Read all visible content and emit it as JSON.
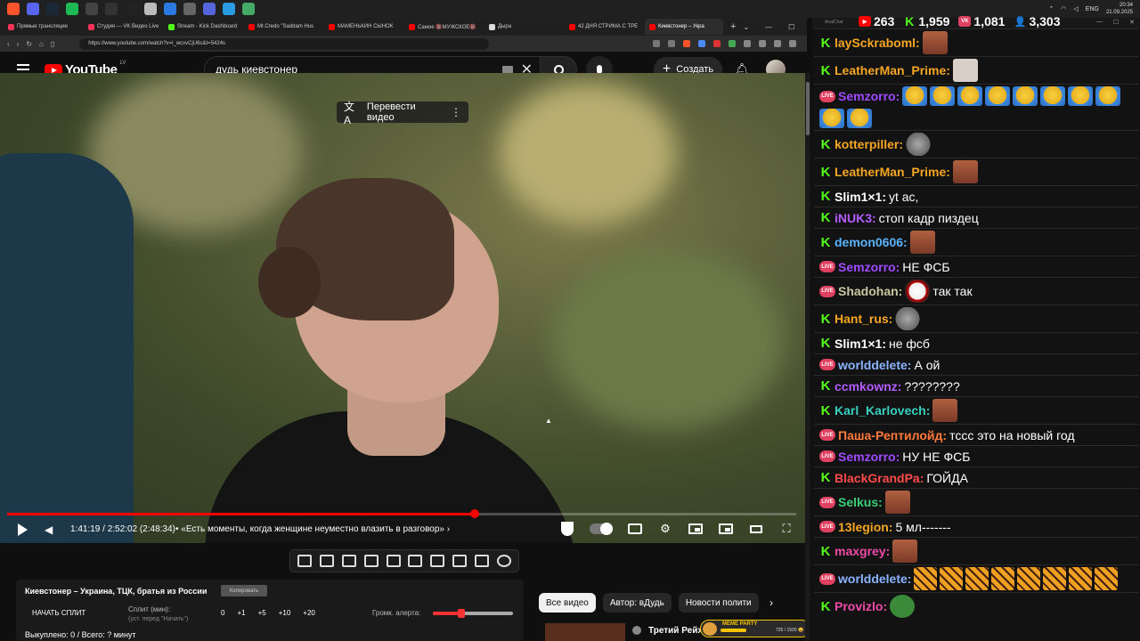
{
  "taskbar": {
    "icons": [
      {
        "name": "brave-icon",
        "color": "#fb542b"
      },
      {
        "name": "discord-icon",
        "color": "#5865f2"
      },
      {
        "name": "steam-icon",
        "color": "#1b2838"
      },
      {
        "name": "spotify-icon",
        "color": "#1db954"
      },
      {
        "name": "app-icon",
        "color": "#444444"
      },
      {
        "name": "epic-icon",
        "color": "#333333"
      },
      {
        "name": "obs-icon",
        "color": "#222222"
      },
      {
        "name": "app-icon",
        "color": "#bbbbbb"
      },
      {
        "name": "app-icon",
        "color": "#2a7ae2"
      },
      {
        "name": "app-icon",
        "color": "#666666"
      },
      {
        "name": "app-icon",
        "color": "#5566dd"
      },
      {
        "name": "app-icon",
        "color": "#2a9ae2"
      },
      {
        "name": "app-icon",
        "color": "#44aa66"
      }
    ],
    "lang": "ENG",
    "time": "20:34",
    "date": "21.09.2025"
  },
  "browser": {
    "tabs": [
      {
        "label": "Прямые трансляции",
        "color": "#ff3355",
        "active": false
      },
      {
        "label": "Студия — VK Видео Live",
        "color": "#ff3355",
        "active": false
      },
      {
        "label": "Stream - Kick Dashboard",
        "color": "#53fc18",
        "active": false
      },
      {
        "label": "Mr.Credo \"Saddam Hus",
        "color": "#ff0000",
        "active": false
      },
      {
        "label": "МАМЕНЬКИН СЫНОК",
        "color": "#ff0000",
        "active": false
      },
      {
        "label": "Самое 🔞МУЖСКОЕ🔞",
        "color": "#ff0000",
        "active": false
      },
      {
        "label": "Дыра",
        "color": "#dddddd",
        "active": false
      },
      {
        "label": "42 ДНЯ СТРИМА С ТРЕ",
        "color": "#ff0000",
        "active": false
      },
      {
        "label": "Киевстонер – Укра",
        "color": "#ff0000",
        "active": true
      }
    ],
    "url": "https://www.youtube.com/watch?v=l_wcxvCjU6c&t=5424s"
  },
  "youtube": {
    "region": "LV",
    "search_query": "дудь киевстонер",
    "create_label": "Создать",
    "translate_label": "Перевести видео",
    "time_display": "1:41:19 / 2:52:02 (2:48:34)",
    "chapter": "• «Есть моменты, когда женщине неуместно влазить в разговор»",
    "progress_fraction": 0.593,
    "chips": [
      {
        "label": "Все видео",
        "active": true
      },
      {
        "label": "Автор: вДудь",
        "active": false
      },
      {
        "label": "Новости полити",
        "active": false
      }
    ],
    "reco_title": "Третий Рейх"
  },
  "split": {
    "title": "Киевстонер – Украина, ТЦК, братья из России",
    "copy_label": "Копировать",
    "start_label": "НАЧАТЬ СПЛИТ",
    "min_label": "Сплит (мин):",
    "min_hint": "(уст. перед \"Начать\")",
    "values": [
      "0",
      "+1",
      "+5",
      "+10",
      "+20"
    ],
    "alert_label": "Громк. алерта:",
    "alert_level": 0.35,
    "sold_text": "Выкуплено: 0 / Всего: ? минут"
  },
  "meme_party": {
    "label": "MEME PARTY",
    "count": "725 / 1500 😀",
    "fraction": 0.483
  },
  "chat": {
    "app_name": "AnalChat",
    "stats": [
      {
        "platform": "youtube",
        "value": "263",
        "color": "#ff0000"
      },
      {
        "platform": "kick",
        "value": "1,959",
        "color": "#53fc18"
      },
      {
        "platform": "vk",
        "value": "1,081",
        "color": "#e04060"
      },
      {
        "platform": "total",
        "value": "3,303",
        "color": "#4aa8ff"
      }
    ],
    "messages": [
      {
        "platform": "kick",
        "user": "laySckraboml:",
        "color": "#f5a623",
        "text": "",
        "emotes": [
          "face"
        ]
      },
      {
        "platform": "kick",
        "user": "LeatherMan_Prime:",
        "color": "#f5a623",
        "text": "",
        "emotes": [
          "cat"
        ]
      },
      {
        "platform": "vk",
        "user": "Semzorro:",
        "color": "#a04aff",
        "text": "",
        "emotes": [
          "cry",
          "cry",
          "cry",
          "cry",
          "cry",
          "cry",
          "cry",
          "cry",
          "cry",
          "cry"
        ]
      },
      {
        "platform": "kick",
        "user": "kotterpiller:",
        "color": "#f5a623",
        "text": "",
        "emotes": [
          "mouse"
        ]
      },
      {
        "platform": "kick",
        "user": "LeatherMan_Prime:",
        "color": "#f5a623",
        "text": "",
        "emotes": [
          "face"
        ]
      },
      {
        "platform": "kick",
        "user": "Slim1×1:",
        "color": "#ffffff",
        "text": "yt ас,",
        "emotes": []
      },
      {
        "platform": "kick",
        "user": "iNUK3:",
        "color": "#b45cff",
        "text": "стоп кадр пиздец",
        "emotes": []
      },
      {
        "platform": "kick",
        "user": "demon0606:",
        "color": "#5ab4ff",
        "text": "",
        "emotes": [
          "face"
        ]
      },
      {
        "platform": "vk",
        "user": "Semzorro:",
        "color": "#a04aff",
        "text": "НЕ ФСБ",
        "emotes": []
      },
      {
        "platform": "vk",
        "user": "Shadohan:",
        "color": "#c8c8a0",
        "text": "так так",
        "emotes": [
          "clown"
        ]
      },
      {
        "platform": "kick",
        "user": "Hant_rus:",
        "color": "#f5a623",
        "text": "",
        "emotes": [
          "mouse"
        ]
      },
      {
        "platform": "kick",
        "user": "Slim1×1:",
        "color": "#ffffff",
        "text": "не фсб",
        "emotes": []
      },
      {
        "platform": "vk",
        "user": "worlddelete:",
        "color": "#8ab4ff",
        "text": "А ой",
        "emotes": []
      },
      {
        "platform": "kick",
        "user": "ccmkownz:",
        "color": "#b45cff",
        "text": "????????",
        "emotes": []
      },
      {
        "platform": "kick",
        "user": "Karl_Karlovech:",
        "color": "#38d0c0",
        "text": "",
        "emotes": [
          "face"
        ]
      },
      {
        "platform": "vk",
        "user": "Паша-Рептилойд:",
        "color": "#ff7a3a",
        "text": "тссс это на новый год",
        "emotes": []
      },
      {
        "platform": "vk",
        "user": "Semzorro:",
        "color": "#a04aff",
        "text": "НУ НЕ ФСБ",
        "emotes": []
      },
      {
        "platform": "kick",
        "user": "BlackGrandPa:",
        "color": "#ff4a4a",
        "text": "ГОЙДА",
        "emotes": []
      },
      {
        "platform": "vk",
        "user": "Selkus:",
        "color": "#38d078",
        "text": "",
        "emotes": [
          "face"
        ]
      },
      {
        "platform": "vk",
        "user": "13legion:",
        "color": "#f5a623",
        "text": "5 мл-------",
        "emotes": []
      },
      {
        "platform": "kick",
        "user": "maxgrey:",
        "color": "#f04aa8",
        "text": "",
        "emotes": [
          "face"
        ]
      },
      {
        "platform": "vk",
        "user": "worlddelete:",
        "color": "#8ab4ff",
        "text": "",
        "emotes": [
          "tiger",
          "tiger",
          "tiger",
          "tiger",
          "tiger",
          "tiger",
          "tiger",
          "tiger"
        ]
      },
      {
        "platform": "kick",
        "user": "Provizlo:",
        "color": "#f04aa8",
        "text": "",
        "emotes": [
          "frog"
        ]
      }
    ]
  }
}
